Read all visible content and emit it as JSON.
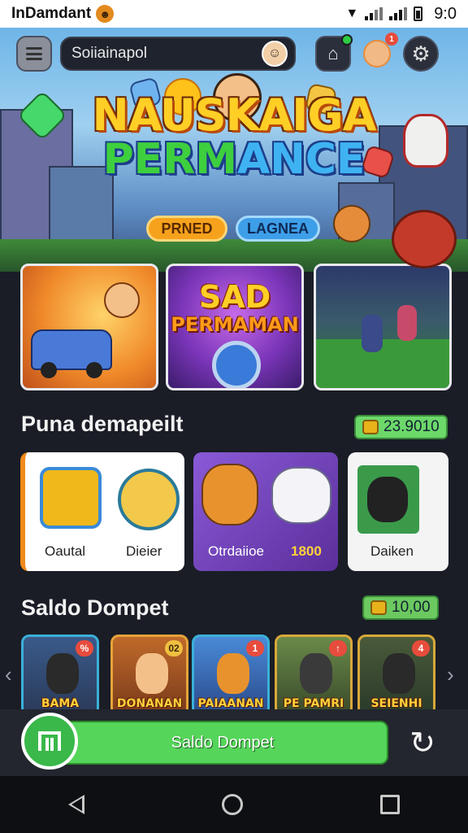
{
  "status_bar": {
    "app_name": "InDamdant",
    "time": "9:0",
    "icons": [
      "wifi-icon",
      "signal-icon",
      "signal-icon",
      "battery-icon"
    ]
  },
  "topbar": {
    "menu_icon": "menu-icon",
    "search_value": "Soiiainapol",
    "shop_icon": "shop-icon",
    "settings_icon": "gear-icon",
    "notification_count": "1"
  },
  "hero": {
    "title_line1": "NAUSKAIGA",
    "title_line2_a": "PERM",
    "title_line2_b": "ANCE",
    "pill_a": "PRNED",
    "pill_b": "LAGNEA"
  },
  "featured": [
    {
      "name": "car-game-card"
    },
    {
      "title": "SAD",
      "subtitle": "PERMAMAN"
    },
    {
      "name": "football-game-card"
    }
  ],
  "section1": {
    "title": "Puna demapeilt",
    "balance": "23.9010"
  },
  "products": [
    {
      "label_a": "Oautal",
      "label_b": "Dieier"
    },
    {
      "label_a": "Otrdaiioe",
      "label_b": "1800"
    },
    {
      "label_a": "Daiken"
    }
  ],
  "section2": {
    "title": "Saldo Dompet",
    "balance": "10,00"
  },
  "tiles": [
    {
      "label": "BAMA",
      "badge": "%"
    },
    {
      "label": "DONANAN",
      "badge": "02"
    },
    {
      "label": "PAIAANAN",
      "badge": "1"
    },
    {
      "label": "PE PAMRI",
      "badge": ""
    },
    {
      "label": "SEIENHI",
      "badge": "4"
    }
  ],
  "bottom": {
    "main_button": "Saldo Dompet"
  },
  "colors": {
    "accent_green": "#55d55a",
    "balance_green": "#6cd86a",
    "background": "#1a1d26"
  }
}
